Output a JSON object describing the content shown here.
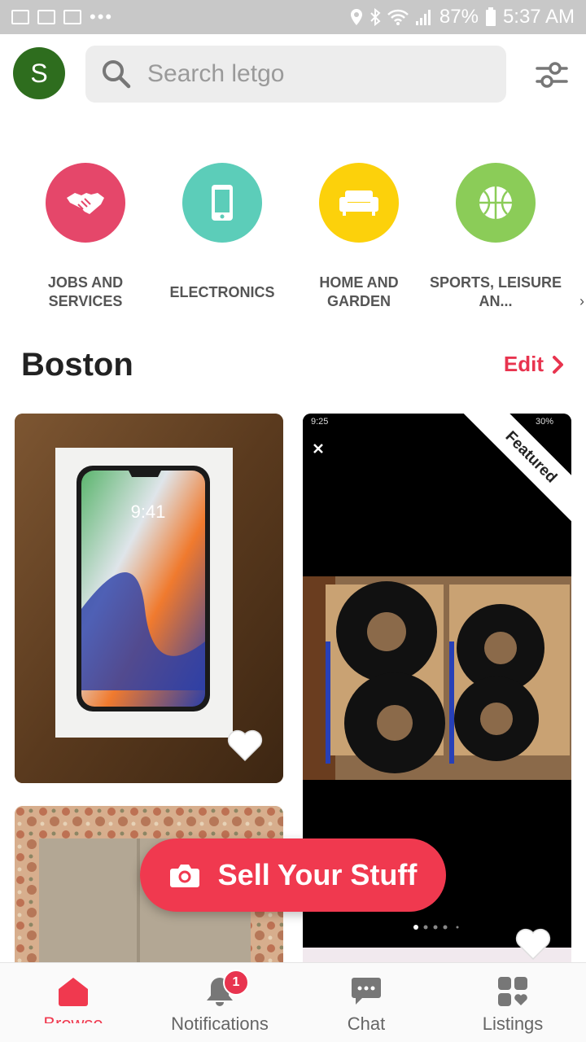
{
  "status_bar": {
    "battery": "87%",
    "time": "5:37 AM"
  },
  "header": {
    "avatar_letter": "S",
    "search_placeholder": "Search letgo"
  },
  "categories": [
    {
      "label": "JOBS AND SERVICES",
      "icon": "handshake-icon",
      "color": "#e5476a"
    },
    {
      "label": "ELECTRONICS",
      "icon": "phone-icon",
      "color": "#5ccdb9"
    },
    {
      "label": "HOME AND GARDEN",
      "icon": "sofa-icon",
      "color": "#fcd10b"
    },
    {
      "label": "SPORTS, LEISURE AN...",
      "icon": "basketball-icon",
      "color": "#8bcc58"
    }
  ],
  "location": {
    "city": "Boston",
    "edit_label": "Edit"
  },
  "listings": [
    {
      "image": "iphone-x-box-photo",
      "favorited": false
    },
    {
      "image": "brake-rotors-photo",
      "badge": "Featured",
      "overlay_time": "9:25",
      "overlay_battery": "30%",
      "favorited": false
    },
    {
      "image": "paisley-cloth-photo",
      "favorited": false
    }
  ],
  "sell_button": {
    "label": "Sell Your Stuff",
    "icon": "camera-icon"
  },
  "bottom_nav": {
    "items": [
      {
        "label": "Browse",
        "icon": "home-icon",
        "active": true
      },
      {
        "label": "Notifications",
        "icon": "bell-icon",
        "badge": "1"
      },
      {
        "label": "Chat",
        "icon": "chat-icon"
      },
      {
        "label": "Listings",
        "icon": "listings-icon"
      }
    ]
  },
  "colors": {
    "accent": "#f0394f",
    "avatar": "#2e6d1e"
  }
}
